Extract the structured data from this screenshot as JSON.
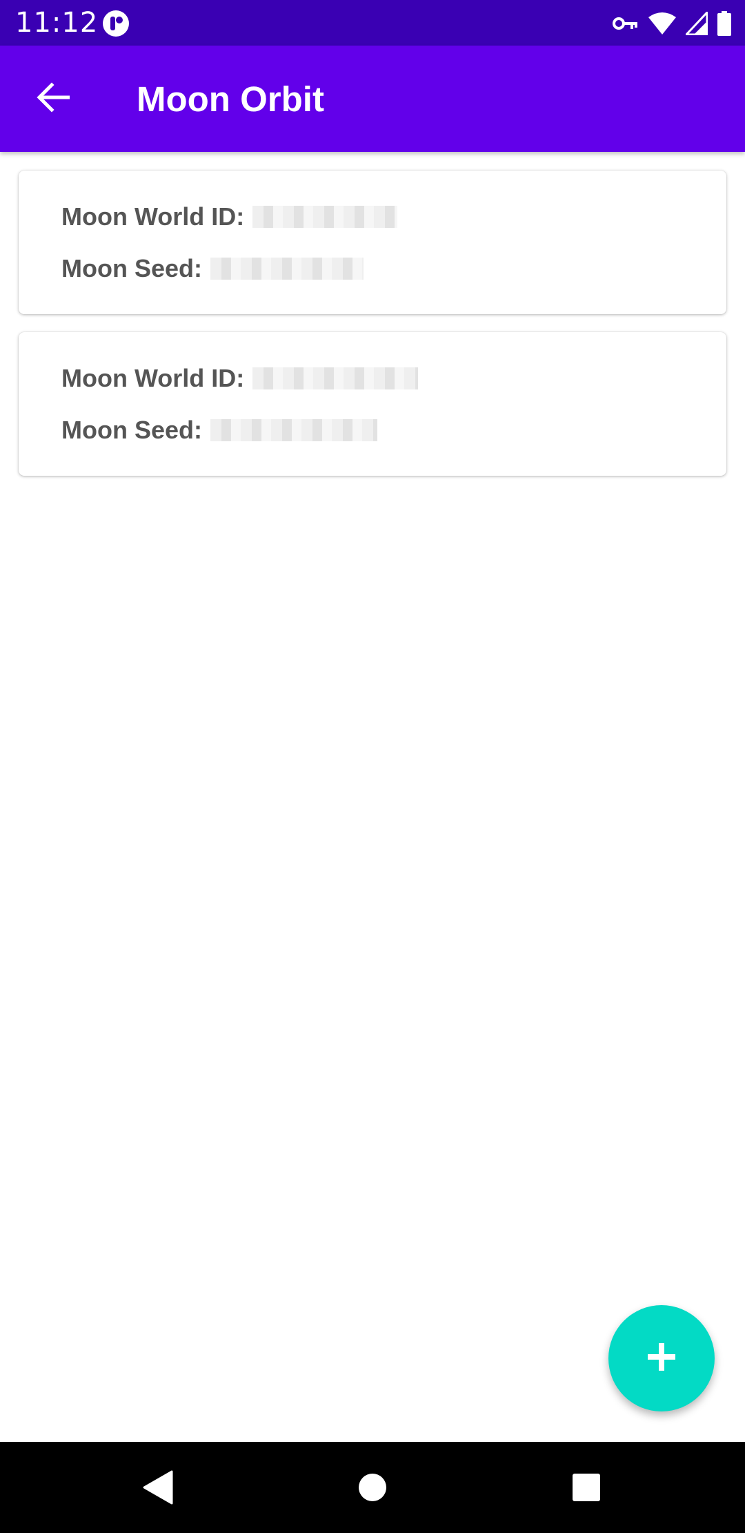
{
  "status_bar": {
    "time": "11:12",
    "icons": [
      "app-notification-icon",
      "vpn-key-icon",
      "wifi-icon",
      "cell-signal-icon",
      "battery-icon"
    ]
  },
  "app_bar": {
    "title": "Moon Orbit",
    "back_icon": "arrow-back-icon",
    "background_color": "#6200ea"
  },
  "cards": [
    {
      "world_id_label": "Moon World ID:",
      "world_id_value": "",
      "seed_label": "Moon Seed:",
      "seed_value": ""
    },
    {
      "world_id_label": "Moon World ID:",
      "world_id_value": "",
      "seed_label": "Moon Seed:",
      "seed_value": ""
    }
  ],
  "fab": {
    "icon": "plus-icon",
    "color": "#03dac5"
  },
  "nav_bar": {
    "icons": [
      "nav-back-icon",
      "nav-home-icon",
      "nav-recents-icon"
    ]
  }
}
